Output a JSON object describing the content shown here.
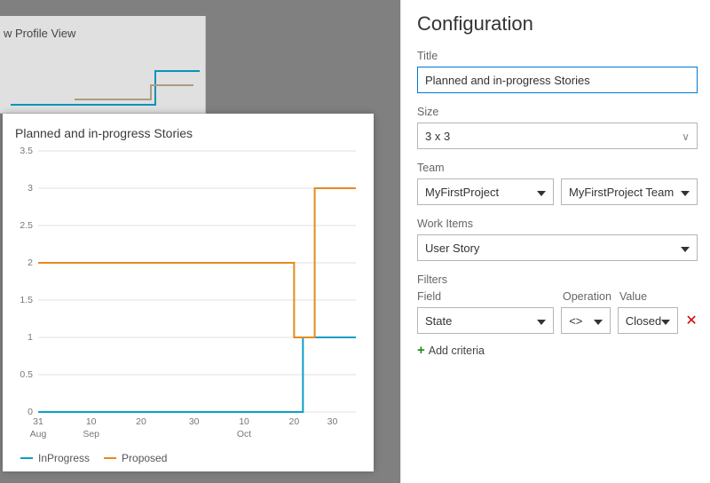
{
  "background": {
    "card_title": "w Profile View"
  },
  "chart_data": {
    "type": "line",
    "title": "Planned and in-progress Stories",
    "ylim": [
      0,
      3.5
    ],
    "ylabel": "",
    "xlabel": "",
    "yticks": [
      0,
      0.5,
      1,
      1.5,
      2,
      2.5,
      3,
      3.5
    ],
    "xticks": [
      {
        "pos": 0.0,
        "top": "31",
        "bottom": "Aug"
      },
      {
        "pos": 0.18,
        "top": "10",
        "bottom": "Sep"
      },
      {
        "pos": 0.35,
        "top": "20",
        "bottom": ""
      },
      {
        "pos": 0.53,
        "top": "30",
        "bottom": ""
      },
      {
        "pos": 0.7,
        "top": "10",
        "bottom": "Oct"
      },
      {
        "pos": 0.87,
        "top": "20",
        "bottom": ""
      },
      {
        "pos": 1.0,
        "top": "30",
        "bottom": ""
      }
    ],
    "series": [
      {
        "name": "InProgress",
        "color": "#0c9fc7",
        "points": [
          {
            "x": 0.0,
            "y": 0
          },
          {
            "x": 0.9,
            "y": 0
          },
          {
            "x": 0.9,
            "y": 1
          },
          {
            "x": 1.08,
            "y": 1
          }
        ]
      },
      {
        "name": "Proposed",
        "color": "#e68a1e",
        "points": [
          {
            "x": 0.0,
            "y": 2
          },
          {
            "x": 0.87,
            "y": 2
          },
          {
            "x": 0.87,
            "y": 1
          },
          {
            "x": 0.94,
            "y": 1
          },
          {
            "x": 0.94,
            "y": 3
          },
          {
            "x": 1.08,
            "y": 3
          }
        ]
      }
    ]
  },
  "config": {
    "heading": "Configuration",
    "title_label": "Title",
    "title_value": "Planned and in-progress Stories",
    "size_label": "Size",
    "size_value": "3 x 3",
    "team_label": "Team",
    "team_project": "MyFirstProject",
    "team_name": "MyFirstProject Team",
    "workitems_label": "Work Items",
    "workitems_value": "User Story",
    "filters_label": "Filters",
    "filters_col_field": "Field",
    "filters_col_op": "Operation",
    "filters_col_value": "Value",
    "filters_row": {
      "field": "State",
      "op": "<>",
      "value": "Closed"
    },
    "add_criteria": "Add criteria"
  }
}
